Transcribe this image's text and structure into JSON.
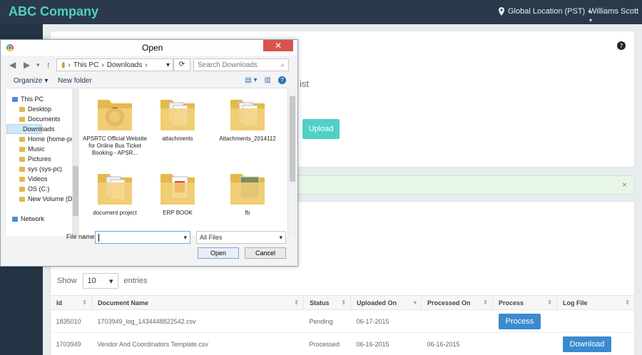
{
  "app": {
    "brand": "ABC Company",
    "location": "Global Location (PST)",
    "user": "Williams Scott",
    "behind_text": "ist",
    "upload_label": "Upload",
    "show_label": "Show",
    "entries_value": "10",
    "entries_label": "entries"
  },
  "table": {
    "headers": [
      "Id",
      "Document Name",
      "Status",
      "Uploaded On",
      "Processed On",
      "Process",
      "Log File"
    ],
    "rows": [
      {
        "id": "1835010",
        "doc": "1703949_log_1434448822542.csv",
        "status": "Pending",
        "uploaded": "06-17-2015",
        "processed": "",
        "process_btn": "Process",
        "log_btn": ""
      },
      {
        "id": "1703949",
        "doc": "Vendor And Coordinators Template.csv",
        "status": "Processed",
        "uploaded": "06-16-2015",
        "processed": "06-16-2015",
        "process_btn": "",
        "log_btn": "Download"
      }
    ]
  },
  "dialog": {
    "title": "Open",
    "path": [
      "This PC",
      "Downloads"
    ],
    "search_placeholder": "Search Downloads",
    "organize": "Organize",
    "new_folder": "New folder",
    "nav_items": [
      {
        "label": "This PC",
        "selected": false,
        "indent": 0
      },
      {
        "label": "Desktop",
        "selected": false,
        "indent": 1
      },
      {
        "label": "Documents",
        "selected": false,
        "indent": 1
      },
      {
        "label": "Downloads",
        "selected": true,
        "indent": 1
      },
      {
        "label": "Home (home-pc",
        "selected": false,
        "indent": 1
      },
      {
        "label": "Music",
        "selected": false,
        "indent": 1
      },
      {
        "label": "Pictures",
        "selected": false,
        "indent": 1
      },
      {
        "label": "sys (sys-pc)",
        "selected": false,
        "indent": 1
      },
      {
        "label": "Videos",
        "selected": false,
        "indent": 1
      },
      {
        "label": "OS (C:)",
        "selected": false,
        "indent": 1
      },
      {
        "label": "New Volume (D:)",
        "selected": false,
        "indent": 1
      },
      {
        "label": "Network",
        "selected": false,
        "indent": 0
      }
    ],
    "files": [
      {
        "label": "APSRTC Official Website for Online Bus Ticket Booking - APSR..."
      },
      {
        "label": "attachments"
      },
      {
        "label": "Attachments_2014112"
      },
      {
        "label": "document project"
      },
      {
        "label": "ERP BOOK"
      },
      {
        "label": "fb"
      }
    ],
    "file_name_label": "File name:",
    "file_type": "All Files",
    "open_label": "Open",
    "cancel_label": "Cancel"
  },
  "colors": {
    "topbar": "#2b3a4a",
    "accent": "#4fd1c5",
    "primary": "#3b8ad0"
  }
}
